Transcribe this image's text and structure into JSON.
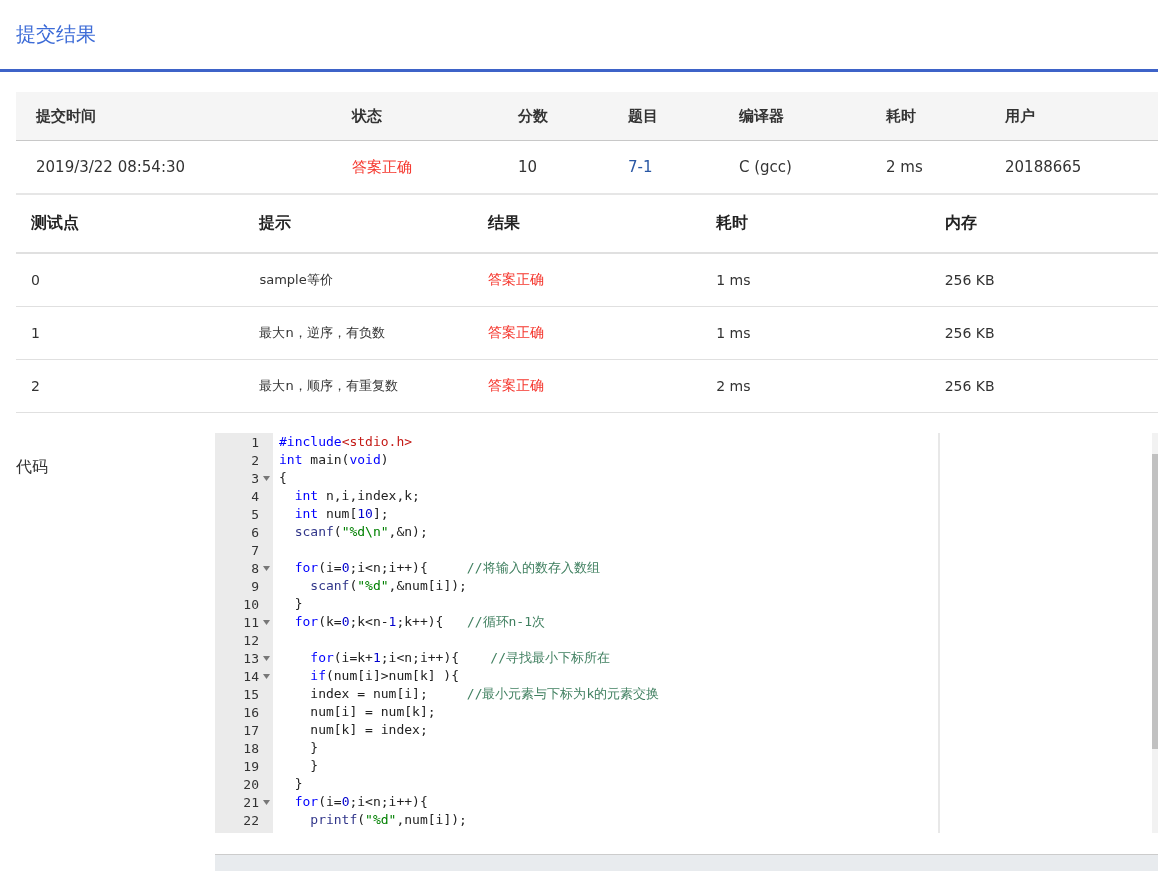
{
  "dialog": {
    "title": "提交结果"
  },
  "submission": {
    "columns": [
      "提交时间",
      "状态",
      "分数",
      "题目",
      "编译器",
      "耗时",
      "用户"
    ],
    "row": [
      {
        "text": "2019/3/22 08:54:30",
        "kind": "plain"
      },
      {
        "text": "答案正确",
        "kind": "status"
      },
      {
        "text": "10",
        "kind": "plain"
      },
      {
        "text": "7-1",
        "kind": "link"
      },
      {
        "text": "C (gcc)",
        "kind": "plain"
      },
      {
        "text": "2 ms",
        "kind": "plain"
      },
      {
        "text": "20188665",
        "kind": "plain"
      }
    ]
  },
  "tests": {
    "columns": [
      "测试点",
      "提示",
      "结果",
      "耗时",
      "内存"
    ],
    "rows": [
      [
        "0",
        "sample等价",
        "答案正确",
        "1 ms",
        "256 KB"
      ],
      [
        "1",
        "最大n，逆序，有负数",
        "答案正确",
        "1 ms",
        "256 KB"
      ],
      [
        "2",
        "最大n，顺序，有重复数",
        "答案正确",
        "2 ms",
        "256 KB"
      ]
    ]
  },
  "code": {
    "label": "代码",
    "lines": [
      {
        "number": "1",
        "fold": false,
        "tokens": [
          {
            "kind": "kw",
            "text": "#include"
          },
          {
            "kind": "inc",
            "text": "<stdio.h>"
          }
        ]
      },
      {
        "number": "2",
        "fold": false,
        "tokens": [
          {
            "kind": "kw",
            "text": "int"
          },
          {
            "kind": "txt",
            "text": " main("
          },
          {
            "kind": "kw",
            "text": "void"
          },
          {
            "kind": "txt",
            "text": ")"
          }
        ]
      },
      {
        "number": "3",
        "fold": true,
        "tokens": [
          {
            "kind": "txt",
            "text": "{"
          }
        ]
      },
      {
        "number": "4",
        "fold": false,
        "tokens": [
          {
            "kind": "kw",
            "text": "  int"
          },
          {
            "kind": "txt",
            "text": " n,i,index,k;"
          }
        ]
      },
      {
        "number": "5",
        "fold": false,
        "tokens": [
          {
            "kind": "kw",
            "text": "  int"
          },
          {
            "kind": "txt",
            "text": " num["
          },
          {
            "kind": "num",
            "text": "10"
          },
          {
            "kind": "txt",
            "text": "];"
          }
        ]
      },
      {
        "number": "6",
        "fold": false,
        "tokens": [
          {
            "kind": "fn",
            "text": "  scanf"
          },
          {
            "kind": "txt",
            "text": "("
          },
          {
            "kind": "str",
            "text": "\"%d\\n\""
          },
          {
            "kind": "txt",
            "text": ",&n);"
          }
        ]
      },
      {
        "number": "7",
        "fold": false
      },
      {
        "number": "8",
        "fold": true,
        "tokens": [
          {
            "kind": "kw",
            "text": "  for"
          },
          {
            "kind": "txt",
            "text": "(i="
          },
          {
            "kind": "num",
            "text": "0"
          },
          {
            "kind": "txt",
            "text": ";i<n;i++){     "
          },
          {
            "kind": "cm",
            "text": "//将输入的数存入数组"
          }
        ]
      },
      {
        "number": "9",
        "fold": false,
        "tokens": [
          {
            "kind": "fn",
            "text": "    scanf"
          },
          {
            "kind": "txt",
            "text": "("
          },
          {
            "kind": "str",
            "text": "\"%d\""
          },
          {
            "kind": "txt",
            "text": ",&num[i]);"
          }
        ]
      },
      {
        "number": "10",
        "fold": false,
        "tokens": [
          {
            "kind": "txt",
            "text": "  }"
          }
        ]
      },
      {
        "number": "11",
        "fold": true,
        "tokens": [
          {
            "kind": "kw",
            "text": "  for"
          },
          {
            "kind": "txt",
            "text": "(k="
          },
          {
            "kind": "num",
            "text": "0"
          },
          {
            "kind": "txt",
            "text": ";k<n-"
          },
          {
            "kind": "num",
            "text": "1"
          },
          {
            "kind": "txt",
            "text": ";k++){   "
          },
          {
            "kind": "cm",
            "text": "//循环n-1次"
          }
        ]
      },
      {
        "number": "12",
        "fold": false
      },
      {
        "number": "13",
        "fold": true,
        "tokens": [
          {
            "kind": "kw",
            "text": "    for"
          },
          {
            "kind": "txt",
            "text": "(i=k+"
          },
          {
            "kind": "num",
            "text": "1"
          },
          {
            "kind": "txt",
            "text": ";i<n;i++){    "
          },
          {
            "kind": "cm",
            "text": "//寻找最小下标所在"
          }
        ]
      },
      {
        "number": "14",
        "fold": true,
        "tokens": [
          {
            "kind": "kw",
            "text": "    if"
          },
          {
            "kind": "txt",
            "text": "(num[i]>num[k] ){"
          }
        ]
      },
      {
        "number": "15",
        "fold": false,
        "tokens": [
          {
            "kind": "txt",
            "text": "    index = num[i];     "
          },
          {
            "kind": "cm",
            "text": "//最小元素与下标为k的元素交换"
          }
        ]
      },
      {
        "number": "16",
        "fold": false,
        "tokens": [
          {
            "kind": "txt",
            "text": "    num[i] = num[k];"
          }
        ]
      },
      {
        "number": "17",
        "fold": false,
        "tokens": [
          {
            "kind": "txt",
            "text": "    num[k] = index;"
          }
        ]
      },
      {
        "number": "18",
        "fold": false,
        "tokens": [
          {
            "kind": "txt",
            "text": "    }"
          }
        ]
      },
      {
        "number": "19",
        "fold": false,
        "tokens": [
          {
            "kind": "txt",
            "text": "    }"
          }
        ]
      },
      {
        "number": "20",
        "fold": false,
        "tokens": [
          {
            "kind": "txt",
            "text": "  }"
          }
        ]
      },
      {
        "number": "21",
        "fold": true,
        "tokens": [
          {
            "kind": "kw",
            "text": "  for"
          },
          {
            "kind": "txt",
            "text": "(i="
          },
          {
            "kind": "num",
            "text": "0"
          },
          {
            "kind": "txt",
            "text": ";i<n;i++){"
          }
        ]
      },
      {
        "number": "22",
        "fold": false,
        "tokens": [
          {
            "kind": "fn",
            "text": "    printf"
          },
          {
            "kind": "txt",
            "text": "("
          },
          {
            "kind": "str",
            "text": "\"%d\""
          },
          {
            "kind": "txt",
            "text": ",num[i]);"
          }
        ]
      }
    ]
  }
}
